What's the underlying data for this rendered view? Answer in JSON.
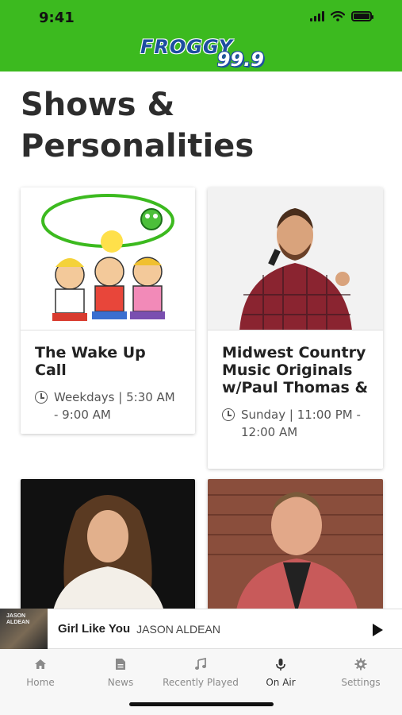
{
  "status_bar": {
    "time": "9:41"
  },
  "header": {
    "logo_word": "FROGGY",
    "logo_frequency": "99.9"
  },
  "page": {
    "title": "Shows & Personalities"
  },
  "shows": [
    {
      "title": "The Wake Up Call",
      "time": "Weekdays | 5:30 AM - 9:00 AM",
      "image_label": "Wake Up Call"
    },
    {
      "title": "Midwest Country Music Originals w/Paul Thomas &",
      "time": "Sunday | 11:00 PM - 12:00 AM"
    }
  ],
  "now_playing": {
    "album_art_text": "JASON ALDEAN",
    "song": "Girl Like You",
    "artist": "JASON ALDEAN"
  },
  "tabs": [
    {
      "label": "Home",
      "icon": "home-icon"
    },
    {
      "label": "News",
      "icon": "news-icon"
    },
    {
      "label": "Recently Played",
      "icon": "music-note-icon"
    },
    {
      "label": "On Air",
      "icon": "microphone-icon",
      "active": true
    },
    {
      "label": "Settings",
      "icon": "gear-icon"
    }
  ],
  "colors": {
    "brand_green": "#3cba1f",
    "logo_blue": "#1d4ea0"
  }
}
